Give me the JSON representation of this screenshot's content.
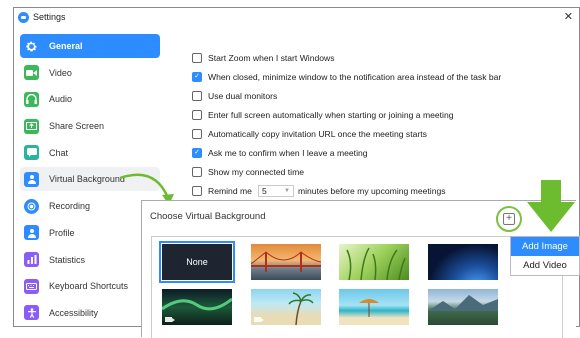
{
  "window": {
    "title": "Settings",
    "close_glyph": "✕"
  },
  "sidebar": {
    "items": [
      {
        "label": "General",
        "icon": "gear-icon",
        "color": "#2d8cff",
        "active": true
      },
      {
        "label": "Video",
        "icon": "video-icon",
        "color": "#3cb85a"
      },
      {
        "label": "Audio",
        "icon": "headphones-icon",
        "color": "#3cb85a"
      },
      {
        "label": "Share Screen",
        "icon": "share-screen-icon",
        "color": "#3cb85a"
      },
      {
        "label": "Chat",
        "icon": "chat-icon",
        "color": "#2bb3a0"
      },
      {
        "label": "Virtual Background",
        "icon": "person-icon",
        "color": "#2d8cff"
      },
      {
        "label": "Recording",
        "icon": "record-icon",
        "color": "#2d8cff"
      },
      {
        "label": "Profile",
        "icon": "profile-icon",
        "color": "#2d8cff"
      },
      {
        "label": "Statistics",
        "icon": "statistics-icon",
        "color": "#8b5cf6"
      },
      {
        "label": "Keyboard Shortcuts",
        "icon": "keyboard-icon",
        "color": "#8b5cf6"
      },
      {
        "label": "Accessibility",
        "icon": "accessibility-icon",
        "color": "#8b5cf6"
      }
    ]
  },
  "options": [
    {
      "label": "Start Zoom when I start Windows",
      "checked": false
    },
    {
      "label": "When closed, minimize window to the notification area instead of the task bar",
      "checked": true
    },
    {
      "label": "Use dual monitors",
      "checked": false
    },
    {
      "label": "Enter full screen automatically when starting or joining a meeting",
      "checked": false
    },
    {
      "label": "Automatically copy invitation URL once the meeting starts",
      "checked": false
    },
    {
      "label": "Ask me to confirm when I leave a meeting",
      "checked": true
    },
    {
      "label": "Show my connected time",
      "checked": false
    }
  ],
  "remind": {
    "prefix": "Remind me",
    "value": "5",
    "suffix": "minutes before my upcoming meetings",
    "checked": false
  },
  "virtual_background": {
    "title": "Choose Virtual Background",
    "none_label": "None",
    "plus_glyph": "+"
  },
  "menu": {
    "add_image": "Add Image",
    "add_video": "Add Video"
  },
  "colors": {
    "accent": "#2d8cff",
    "highlight_green": "#7cc142",
    "arrow_green": "#6dbb2e"
  }
}
